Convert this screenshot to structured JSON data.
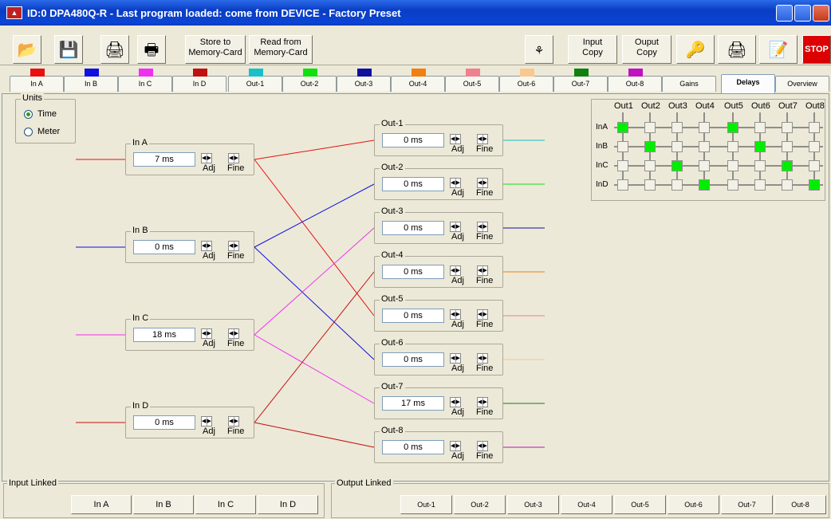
{
  "window": {
    "title": "ID:0 DPA480Q-R - Last program loaded: come from DEVICE - Factory Preset"
  },
  "toolbar": {
    "store_label_1": "Store to",
    "store_label_2": "Memory-Card",
    "read_label_1": "Read from",
    "read_label_2": "Memory-Card",
    "input_copy_1": "Input",
    "input_copy_2": "Copy",
    "output_copy_1": "Ouput",
    "output_copy_2": "Copy",
    "stop_label": "STOP"
  },
  "tabs": [
    {
      "label": "In A",
      "color": "#e81010"
    },
    {
      "label": "In B",
      "color": "#1010e0"
    },
    {
      "label": "In C",
      "color": "#f030f0"
    },
    {
      "label": "In D",
      "color": "#c01010"
    },
    {
      "label": "Out-1",
      "color": "#18c0c8"
    },
    {
      "label": "Out-2",
      "color": "#10e010"
    },
    {
      "label": "Out-3",
      "color": "#1010a0"
    },
    {
      "label": "Out-4",
      "color": "#f08010"
    },
    {
      "label": "Out-5",
      "color": "#f08090"
    },
    {
      "label": "Out-6",
      "color": "#f8c890"
    },
    {
      "label": "Out-7",
      "color": "#108010"
    },
    {
      "label": "Out-8",
      "color": "#c010c0"
    },
    {
      "label": "Gains",
      "color": ""
    },
    {
      "label": "Delays",
      "color": ""
    },
    {
      "label": "Overview",
      "color": ""
    }
  ],
  "active_tab": "Delays",
  "units": {
    "label": "Units",
    "options": [
      "Time",
      "Meter"
    ],
    "selected": "Time"
  },
  "spin_labels": {
    "adj": "Adj",
    "fine": "Fine"
  },
  "inputs": [
    {
      "label": "In A",
      "value": "7 ms",
      "color": "#e81010"
    },
    {
      "label": "In B",
      "value": "0 ms",
      "color": "#1010e0"
    },
    {
      "label": "In C",
      "value": "18 ms",
      "color": "#f030f0"
    },
    {
      "label": "In D",
      "value": "0 ms",
      "color": "#c01010"
    }
  ],
  "outputs": [
    {
      "label": "Out-1",
      "value": "0 ms",
      "color": "#18c0c8"
    },
    {
      "label": "Out-2",
      "value": "0 ms",
      "color": "#10e010"
    },
    {
      "label": "Out-3",
      "value": "0 ms",
      "color": "#1010a0"
    },
    {
      "label": "Out-4",
      "value": "0 ms",
      "color": "#f08010"
    },
    {
      "label": "Out-5",
      "value": "0 ms",
      "color": "#f08090"
    },
    {
      "label": "Out-6",
      "value": "0 ms",
      "color": "#f8c890"
    },
    {
      "label": "Out-7",
      "value": "17 ms",
      "color": "#108010"
    },
    {
      "label": "Out-8",
      "value": "0 ms",
      "color": "#c010c0"
    }
  ],
  "routing": [
    {
      "from": 0,
      "to": 0,
      "color": "#e81010"
    },
    {
      "from": 0,
      "to": 4,
      "color": "#e81010"
    },
    {
      "from": 1,
      "to": 1,
      "color": "#1010e0"
    },
    {
      "from": 1,
      "to": 5,
      "color": "#1010e0"
    },
    {
      "from": 2,
      "to": 2,
      "color": "#f030f0"
    },
    {
      "from": 2,
      "to": 6,
      "color": "#f030f0"
    },
    {
      "from": 3,
      "to": 3,
      "color": "#c01010"
    },
    {
      "from": 3,
      "to": 7,
      "color": "#c01010"
    }
  ],
  "matrix": {
    "columns": [
      "Out1",
      "Out2",
      "Out3",
      "Out4",
      "Out5",
      "Out6",
      "Out7",
      "Out8"
    ],
    "rows": [
      "InA",
      "InB",
      "InC",
      "InD"
    ],
    "on": [
      [
        1,
        0,
        0,
        0,
        1,
        0,
        0,
        0
      ],
      [
        0,
        1,
        0,
        0,
        0,
        1,
        0,
        0
      ],
      [
        0,
        0,
        1,
        0,
        0,
        0,
        1,
        0
      ],
      [
        0,
        0,
        0,
        1,
        0,
        0,
        0,
        1
      ]
    ]
  },
  "input_linked": {
    "label": "Input Linked",
    "buttons": [
      "In A",
      "In B",
      "In C",
      "In D"
    ]
  },
  "output_linked": {
    "label": "Output Linked",
    "buttons": [
      "Out-1",
      "Out-2",
      "Out-3",
      "Out-4",
      "Out-5",
      "Out-6",
      "Out-7",
      "Out-8"
    ]
  }
}
